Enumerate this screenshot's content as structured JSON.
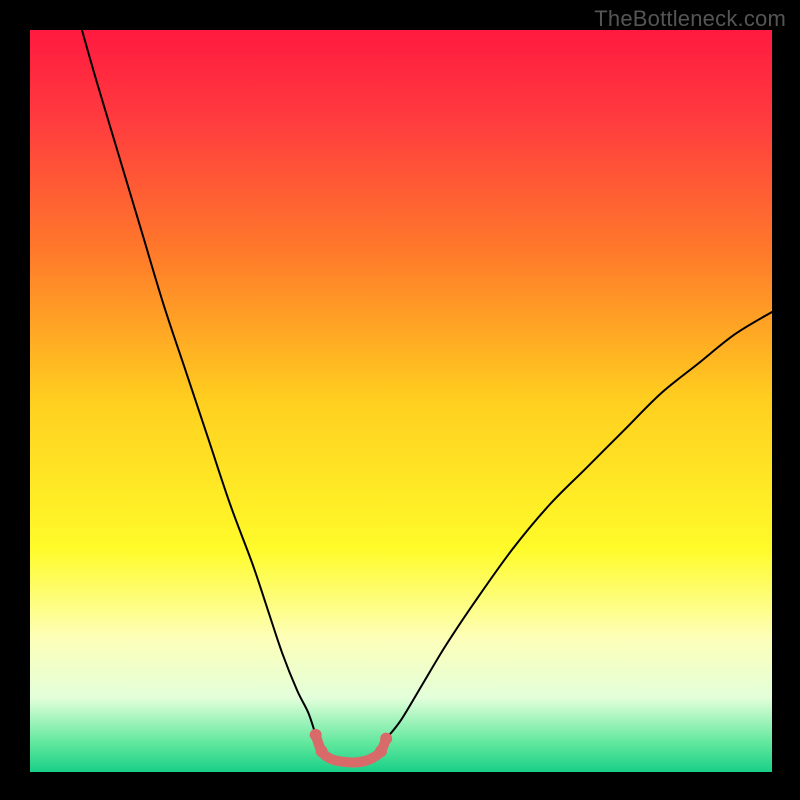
{
  "watermark": "TheBottleneck.com",
  "chart_data": {
    "type": "line",
    "title": "",
    "xlabel": "",
    "ylabel": "",
    "xlim": [
      0,
      100
    ],
    "ylim": [
      0,
      100
    ],
    "grid": false,
    "legend": false,
    "gradient_stops": [
      {
        "offset": 0.0,
        "color": "#ff1a3f"
      },
      {
        "offset": 0.12,
        "color": "#ff3b3f"
      },
      {
        "offset": 0.3,
        "color": "#ff7a2a"
      },
      {
        "offset": 0.5,
        "color": "#ffcf1f"
      },
      {
        "offset": 0.7,
        "color": "#fffb2a"
      },
      {
        "offset": 0.82,
        "color": "#fdffb9"
      },
      {
        "offset": 0.9,
        "color": "#e3ffda"
      },
      {
        "offset": 0.96,
        "color": "#62e89e"
      },
      {
        "offset": 1.0,
        "color": "#19cf87"
      }
    ],
    "series": [
      {
        "name": "left-curve",
        "stroke": "#000000",
        "stroke_width": 2,
        "points": [
          {
            "x": 7,
            "y": 100
          },
          {
            "x": 9,
            "y": 93
          },
          {
            "x": 12,
            "y": 83
          },
          {
            "x": 15,
            "y": 73
          },
          {
            "x": 18,
            "y": 63
          },
          {
            "x": 21,
            "y": 54
          },
          {
            "x": 24,
            "y": 45
          },
          {
            "x": 27,
            "y": 36
          },
          {
            "x": 30,
            "y": 28
          },
          {
            "x": 32,
            "y": 22
          },
          {
            "x": 34,
            "y": 16
          },
          {
            "x": 36,
            "y": 11
          },
          {
            "x": 37.5,
            "y": 8
          },
          {
            "x": 38.5,
            "y": 5
          }
        ]
      },
      {
        "name": "right-curve",
        "stroke": "#000000",
        "stroke_width": 2,
        "points": [
          {
            "x": 48,
            "y": 4.5
          },
          {
            "x": 50,
            "y": 7
          },
          {
            "x": 53,
            "y": 12
          },
          {
            "x": 56,
            "y": 17
          },
          {
            "x": 60,
            "y": 23
          },
          {
            "x": 65,
            "y": 30
          },
          {
            "x": 70,
            "y": 36
          },
          {
            "x": 75,
            "y": 41
          },
          {
            "x": 80,
            "y": 46
          },
          {
            "x": 85,
            "y": 51
          },
          {
            "x": 90,
            "y": 55
          },
          {
            "x": 95,
            "y": 59
          },
          {
            "x": 100,
            "y": 62
          }
        ]
      },
      {
        "name": "bottom-segment",
        "stroke": "#d86a6a",
        "stroke_width": 10,
        "points": [
          {
            "x": 38.5,
            "y": 5.0
          },
          {
            "x": 39.0,
            "y": 3.5
          },
          {
            "x": 39.5,
            "y": 2.5
          },
          {
            "x": 40.5,
            "y": 1.8
          },
          {
            "x": 42.0,
            "y": 1.4
          },
          {
            "x": 44.0,
            "y": 1.3
          },
          {
            "x": 45.5,
            "y": 1.6
          },
          {
            "x": 46.8,
            "y": 2.3
          },
          {
            "x": 47.5,
            "y": 3.2
          },
          {
            "x": 48.0,
            "y": 4.5
          }
        ]
      }
    ],
    "markers": [
      {
        "x": 38.5,
        "y": 5.0,
        "r": 6,
        "color": "#d86a6a"
      },
      {
        "x": 39.3,
        "y": 2.8,
        "r": 6,
        "color": "#d86a6a"
      },
      {
        "x": 47.3,
        "y": 2.8,
        "r": 6,
        "color": "#d86a6a"
      },
      {
        "x": 48.0,
        "y": 4.5,
        "r": 6,
        "color": "#d86a6a"
      }
    ]
  }
}
